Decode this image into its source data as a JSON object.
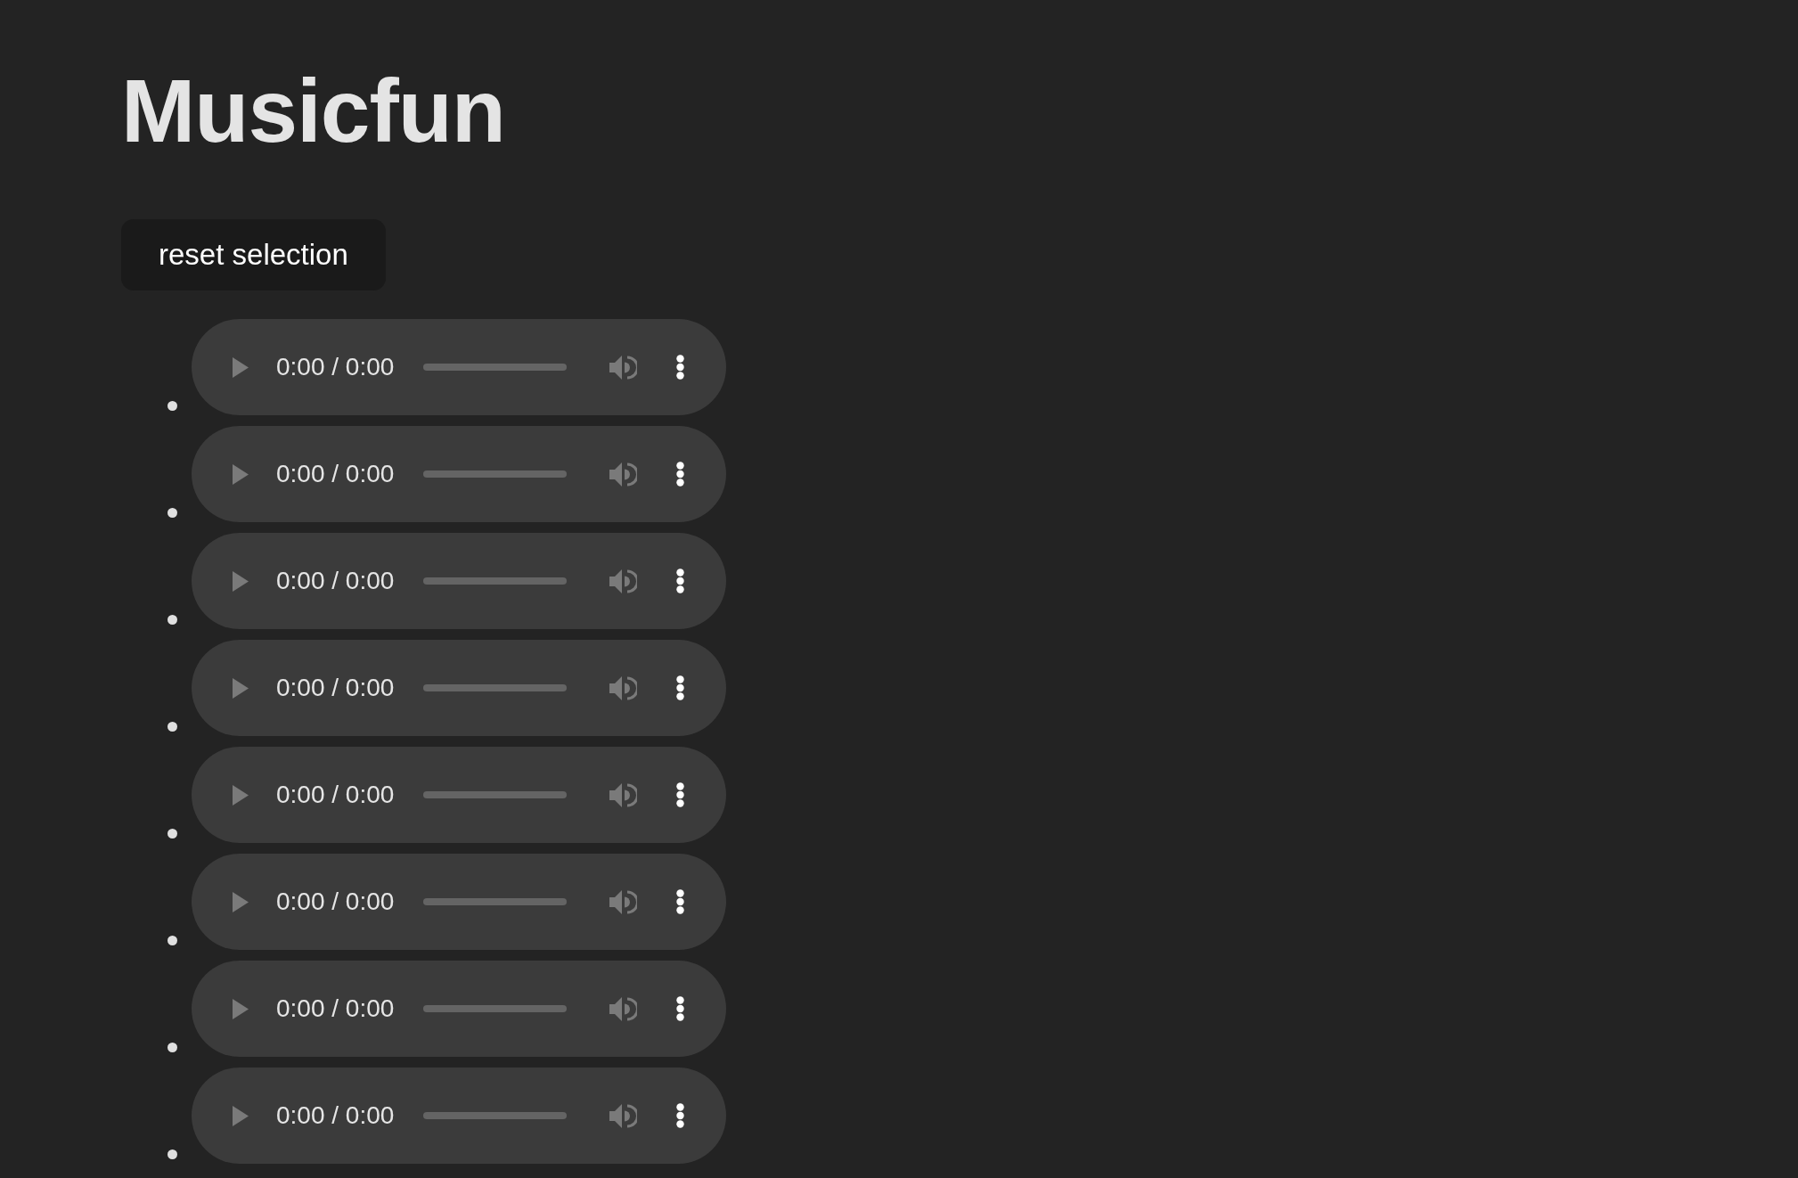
{
  "title": "Musicfun",
  "reset_button": {
    "label": "reset selection"
  },
  "players": [
    {
      "time": "0:00 / 0:00",
      "muted": false
    },
    {
      "time": "0:00 / 0:00",
      "muted": false
    },
    {
      "time": "0:00 / 0:00",
      "muted": false
    },
    {
      "time": "0:00 / 0:00",
      "muted": false
    },
    {
      "time": "0:00 / 0:00",
      "muted": false
    },
    {
      "time": "0:00 / 0:00",
      "muted": false
    },
    {
      "time": "0:00 / 0:00",
      "muted": false
    },
    {
      "time": "0:00 / 0:00",
      "muted": false
    }
  ]
}
